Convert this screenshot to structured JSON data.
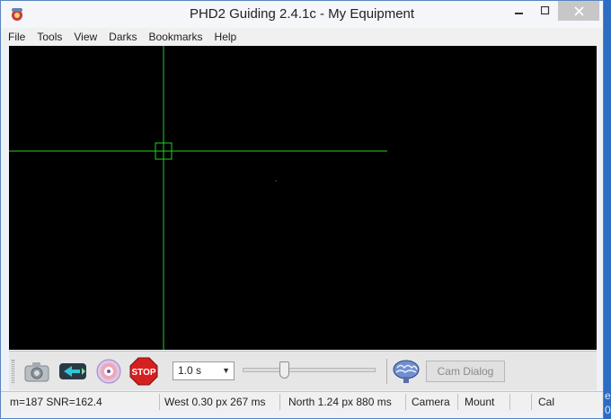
{
  "window": {
    "title": "PHD2 Guiding 2.4.1c - My Equipment"
  },
  "menu": [
    "File",
    "Tools",
    "View",
    "Darks",
    "Bookmarks",
    "Help"
  ],
  "toolbar": {
    "exposure_value": "1.0 s",
    "exposure_slider_level": 0.3,
    "cam_dialog_label": "Cam Dialog"
  },
  "icons": {
    "camera": "camera-icon",
    "loop": "loop-icon",
    "guide": "guide-icon",
    "stop": "stop-icon",
    "brain": "brain-icon"
  },
  "stop_label": "STOP",
  "status": {
    "snr": "m=187 SNR=162.4",
    "west": "West  0.30 px 267 ms",
    "north": "North 1.24 px 880 ms",
    "camera": "Camera",
    "mount": "Mount",
    "cal": "Cal"
  },
  "edge": {
    "a": "e",
    "b": "0"
  },
  "colors": {
    "crosshair": "#1fd11f",
    "viewport_bg": "#000000",
    "stop_red": "#d62020"
  }
}
